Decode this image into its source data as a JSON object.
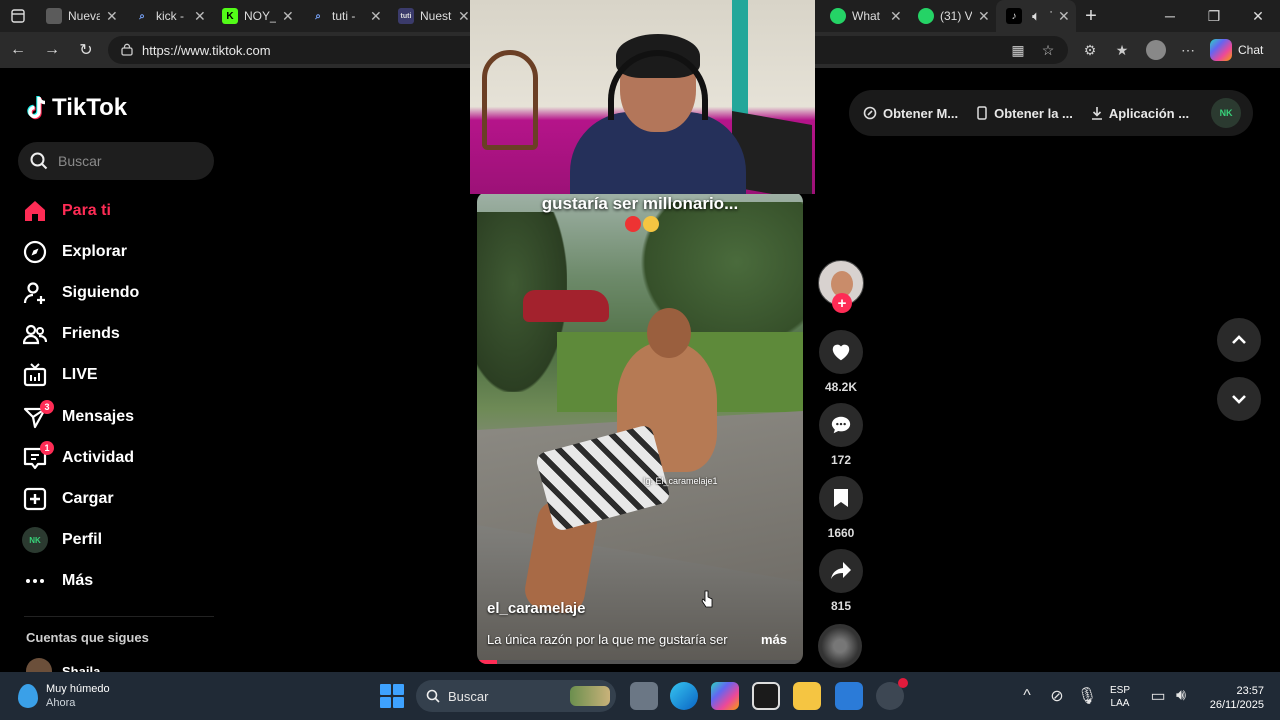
{
  "browser": {
    "tabs": [
      {
        "label": "Nueva",
        "favicon_color": "#5b5b5b",
        "favicon": "window-icon"
      },
      {
        "label": "kick -",
        "favicon_color": "#1f1f1f",
        "favicon": "search-icon"
      },
      {
        "label": "NOY_",
        "favicon_color": "#53fc18",
        "favicon": "kick-icon"
      },
      {
        "label": "tuti -",
        "favicon_color": "#1f1f1f",
        "favicon": "search-icon"
      },
      {
        "label": "Nuest",
        "favicon_color": "#3b3b6b",
        "favicon": "tuti-icon"
      }
    ],
    "tabs_right": [
      {
        "label": "What",
        "favicon_color": "#25d366",
        "favicon": "whatsapp-icon"
      },
      {
        "label": "(31) V",
        "favicon_color": "#25d366",
        "favicon": "whatsapp-icon"
      },
      {
        "label": "T",
        "favicon_color": "#000000",
        "favicon": "tiktok-icon"
      }
    ],
    "url": "https://www.tiktok.com",
    "chat_label": "Chat"
  },
  "tiktok": {
    "logo_text": "TikTok",
    "search_placeholder": "Buscar",
    "nav": [
      {
        "label": "Para ti",
        "icon": "home-icon",
        "active": true
      },
      {
        "label": "Explorar",
        "icon": "compass-icon"
      },
      {
        "label": "Siguiendo",
        "icon": "following-icon"
      },
      {
        "label": "Friends",
        "icon": "friends-icon"
      },
      {
        "label": "LIVE",
        "icon": "live-icon"
      },
      {
        "label": "Mensajes",
        "icon": "messages-icon",
        "badge": "3"
      },
      {
        "label": "Actividad",
        "icon": "activity-icon",
        "badge": "1"
      },
      {
        "label": "Cargar",
        "icon": "upload-icon"
      },
      {
        "label": "Perfil",
        "icon": "profile-icon"
      },
      {
        "label": "Más",
        "icon": "more-icon"
      }
    ],
    "following_title": "Cuentas que sigues",
    "following_first": "Shaila",
    "top_buttons": {
      "coins": "Obtener M...",
      "app": "Obtener la ...",
      "download": "Aplicación ..."
    },
    "video": {
      "caption_top": "gustaría ser millonario...",
      "watermark": "Ig: El_caramelaje1",
      "author": "el_caramelaje",
      "description": "La única razón por la que me gustaría ser",
      "more": "más",
      "progress": 0.06
    },
    "actions": {
      "likes": "48.2K",
      "comments": "172",
      "saves": "1660",
      "shares": "815"
    },
    "accent": "#fe2c55"
  },
  "taskbar": {
    "weather_title": "Muy húmedo",
    "weather_sub": "Ahora",
    "search": "Buscar",
    "lang_1": "ESP",
    "lang_2": "LAA",
    "time": "23:57",
    "date": "26/11/2025"
  }
}
